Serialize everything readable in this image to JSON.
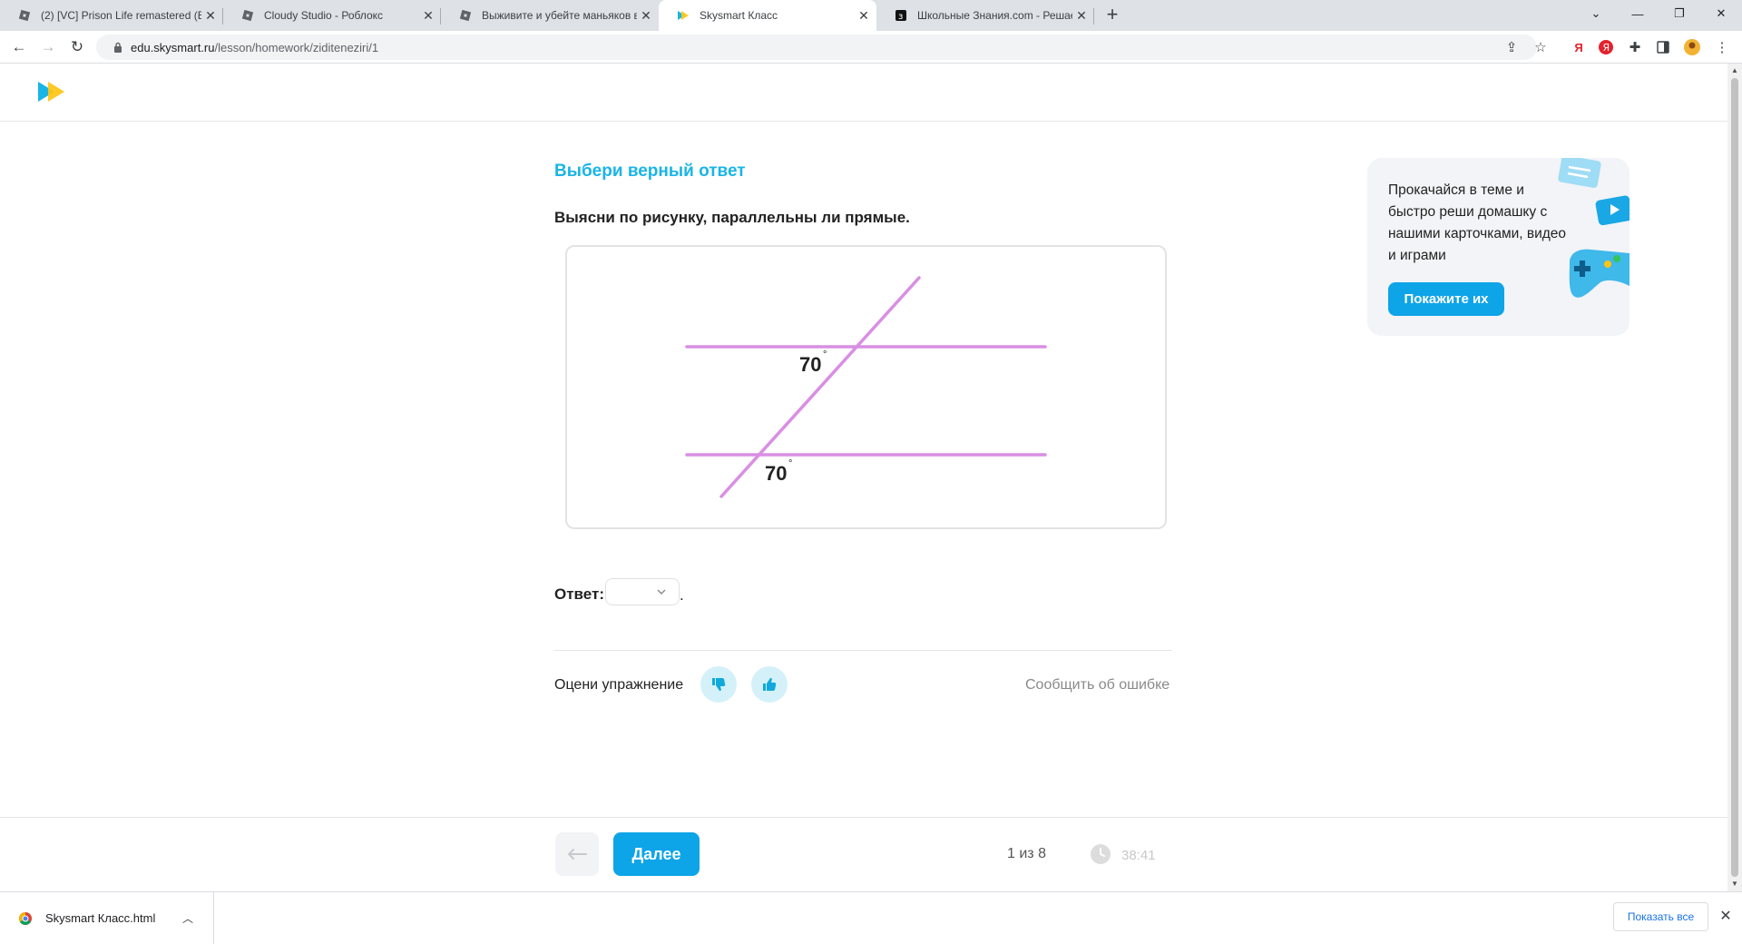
{
  "browser": {
    "tabs": [
      {
        "title": "(2) [VC] Prison Life remastered (В",
        "active": false
      },
      {
        "title": "Cloudy Studio - Роблокс",
        "active": false
      },
      {
        "title": "Выживите и убейте маньяков в",
        "active": false
      },
      {
        "title": "Skysmart Класс",
        "active": true
      },
      {
        "title": "Школьные Знания.com - Решае",
        "active": false
      }
    ],
    "new_tab_label": "+",
    "url_host": "edu.skysmart.ru",
    "url_path": "/lesson/homework/ziditeneziri/1"
  },
  "exercise": {
    "title": "Выбери верный ответ",
    "task": "Выясни по рисунку, параллельны ли прямые.",
    "figure": {
      "angle_top": "70",
      "angle_bottom": "70",
      "degree_symbol": "°",
      "line_color": "#d98ee3"
    },
    "answer_label": "Ответ:",
    "answer_value": "",
    "answer_suffix": ".",
    "rate_label": "Оцени упражнение",
    "report_label": "Сообщить об ошибке"
  },
  "promo": {
    "text": "Прокачайся в теме и быстро реши домашку с нашими карточками, видео и играми",
    "button": "Покажите их"
  },
  "footer": {
    "next_label": "Далее",
    "counter": "1 из 8",
    "timer": "38:41"
  },
  "downloads": {
    "file_name": "Skysmart Класс.html",
    "show_all": "Показать все"
  },
  "colors": {
    "accent": "#0ea4e8",
    "title": "#19b5e6",
    "rate_button_bg": "#d4f1fa"
  }
}
